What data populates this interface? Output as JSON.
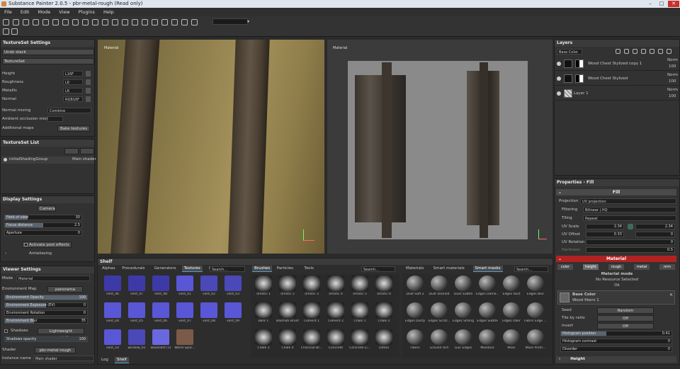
{
  "app": {
    "title": "Substance Painter 2.0.5 - pbr-metal-rough (Read only)"
  },
  "menu": [
    "File",
    "Edit",
    "Mode",
    "View",
    "Plugins",
    "Help"
  ],
  "textureset_settings": {
    "title": "TextureSet Settings",
    "undo_stack": "Undo stack",
    "textureset": "TextureSet",
    "channels": [
      {
        "name": "Height",
        "format": "L16F"
      },
      {
        "name": "Roughness",
        "format": "L8"
      },
      {
        "name": "Metallic",
        "format": "L8"
      },
      {
        "name": "Normal",
        "format": "RGB16F"
      }
    ],
    "normal_mixing_label": "Normal mixing",
    "normal_mixing_value": "Combine",
    "ao_mixing_label": "Ambient occlusion mixing",
    "additional_maps_label": "Additional maps",
    "bake_textures": "Bake textures"
  },
  "textureset_list": {
    "title": "TextureSet List",
    "item": "initialShadingGroup",
    "shader": "Main shader"
  },
  "display_settings": {
    "title": "Display Settings",
    "camera": "Camera",
    "fov_label": "Field of view",
    "fov_value": "30",
    "fov_fraction": 0.3,
    "focus_label": "Focus distance",
    "focus_value": "2.5",
    "focus_fraction": 0.5,
    "aperture_label": "Aperture",
    "aperture_value": "0",
    "aperture_fraction": 0,
    "post_effects": "Activate post effects",
    "anti_aliasing": "Antialiasing"
  },
  "viewer_settings": {
    "title": "Viewer Settings",
    "mode_label": "Mode",
    "mode_value": "Material",
    "env_map_label": "Environment Map",
    "env_map_value": "panorama",
    "sliders": [
      {
        "label": "Environment Opacity",
        "value": "100",
        "fraction": 1
      },
      {
        "label": "Environment Exposure (EV)",
        "value": "0",
        "fraction": 0.5
      },
      {
        "label": "Environment Rotation",
        "value": "0",
        "fraction": 0
      },
      {
        "label": "Environment Blur",
        "value": "35",
        "fraction": 0.35
      }
    ],
    "shadows_label": "Shadows",
    "shadows_value": "Lightweight computation",
    "shadows_opacity_label": "Shadows opacity",
    "shadows_opacity_value": "100",
    "shader_label": "Shader",
    "shader_value": "pbr-metal-rough",
    "instance_label": "Instance name",
    "instance_value": "Main shader"
  },
  "viewport3d": {
    "label": "Material"
  },
  "viewport2d": {
    "label": "Material"
  },
  "shelf": {
    "title": "Shelf",
    "tabs1": [
      "Alphas",
      "Procedurals",
      "Generators",
      "Textures",
      "Fi"
    ],
    "search1": "Search...",
    "textures": [
      {
        "name": "vent_46",
        "bg": "#3d3aa8"
      },
      {
        "name": "vent_47",
        "bg": "#3d3aa8"
      },
      {
        "name": "vent_48",
        "bg": "#3d3aa8"
      },
      {
        "name": "vent_01",
        "bg": "#5a57d6"
      },
      {
        "name": "vent_02",
        "bg": "#4b48b8"
      },
      {
        "name": "vent_03",
        "bg": "#4b48b8"
      },
      {
        "name": "vent_04",
        "bg": "#5a57d6"
      },
      {
        "name": "vent_05",
        "bg": "#5a57d6"
      },
      {
        "name": "vent_06",
        "bg": "#5a57d6"
      },
      {
        "name": "vent_07",
        "bg": "#5a57d6"
      },
      {
        "name": "vent_08",
        "bg": "#5a57d6"
      },
      {
        "name": "vent_09",
        "bg": "#5a57d6"
      },
      {
        "name": "vent_10",
        "bg": "#5a57d6"
      },
      {
        "name": "window_01",
        "bg": "#4b48b8"
      },
      {
        "name": "woodTest (1)",
        "bg": "#6a68e0"
      },
      {
        "name": "World Spac...",
        "bg": "#7b5a4a"
      }
    ],
    "tabs2": [
      "Brushes",
      "Particles",
      "Tools"
    ],
    "search2": "Search...",
    "brushes": [
      "artistic 1",
      "artistic 2",
      "artistic 3",
      "artistic 4",
      "artistic 5",
      "artistic 6",
      "Bark 1",
      "Basmati Brush",
      "Cement 1",
      "Cement 2",
      "Chalk 1",
      "Chalk 2",
      "Chalk 3",
      "Chalk 4",
      "Charcoal Br...",
      "Concrete",
      "Concrete Li...",
      "cotton"
    ],
    "tabs3": [
      "Materials",
      "Smart materials",
      "Smart masks"
    ],
    "search3": "Search...",
    "masks": [
      "Dust Soft 2",
      "Dust Stained",
      "Dust Subtle",
      "Edges Dama...",
      "Edges Rust",
      "Edges Blur",
      "Edges Dusty",
      "Edges Scrat...",
      "Edges Strong",
      "Edges Subtle",
      "Edges Uber",
      "Fabric Edge ...",
      "Fibers",
      "Ground Dirt",
      "Gun Edges",
      "Moisture",
      "Moss",
      "Moss Prom..."
    ],
    "bottom_tabs": [
      "Log",
      "Shelf"
    ]
  },
  "layers": {
    "title": "Layers",
    "channel": "Base Color",
    "items": [
      {
        "name": "Wood Chest Stylized copy 1",
        "blend": "Norm",
        "opacity": "100"
      },
      {
        "name": "Wood Chest Stylized",
        "blend": "Norm",
        "opacity": "100"
      },
      {
        "name": "Layer 1",
        "blend": "Norm",
        "opacity": "100"
      }
    ]
  },
  "properties": {
    "title": "Properties - Fill",
    "fill": "Fill",
    "projection_label": "Projection",
    "projection_value": "UV projection",
    "filtering_label": "Filtering",
    "filtering_value": "Bilinear | HQ",
    "tiling_label": "Tiling",
    "tiling_value": "Repeat",
    "uvscale_label": "UV Scale",
    "uvscale_value": "2.34",
    "uvscale_value2": "2.34",
    "uvoffset_label": "UV Offset",
    "uvoffset_value": "0.33",
    "uvoffset_value2": "0",
    "uvrot_label": "UV Rotation",
    "uvrot_value": "0",
    "hardness_label": "Hardness",
    "hardness_value": "0.5",
    "material": "Material",
    "chips": [
      "color",
      "height",
      "rough",
      "metal",
      "nrm"
    ],
    "material_mode": "Material mode",
    "no_resource": "No Resource Selected",
    "ok": "Ok",
    "basecolor_label": "Base Color",
    "basecolor_value": "Wood fibers 1",
    "seed_label": "Seed",
    "seed_value": "Random",
    "tile_label": "Tile by ratio",
    "tile_value": "Off",
    "invert_label": "Invert",
    "invert_value": "Off",
    "histpos_label": "Histogram position",
    "histpos_value": "0.41",
    "histpos_fraction": 0.41,
    "histcont_label": "Histogram contrast",
    "histcont_value": "0",
    "histcont_fraction": 0,
    "disorder_label": "Disorder",
    "disorder_value": "0",
    "disorder_fraction": 0,
    "height_label": "Height"
  },
  "colors": {
    "accent": "#4aa3d8",
    "material_header": "#b22222",
    "fill_header": "#4a4a4a"
  }
}
